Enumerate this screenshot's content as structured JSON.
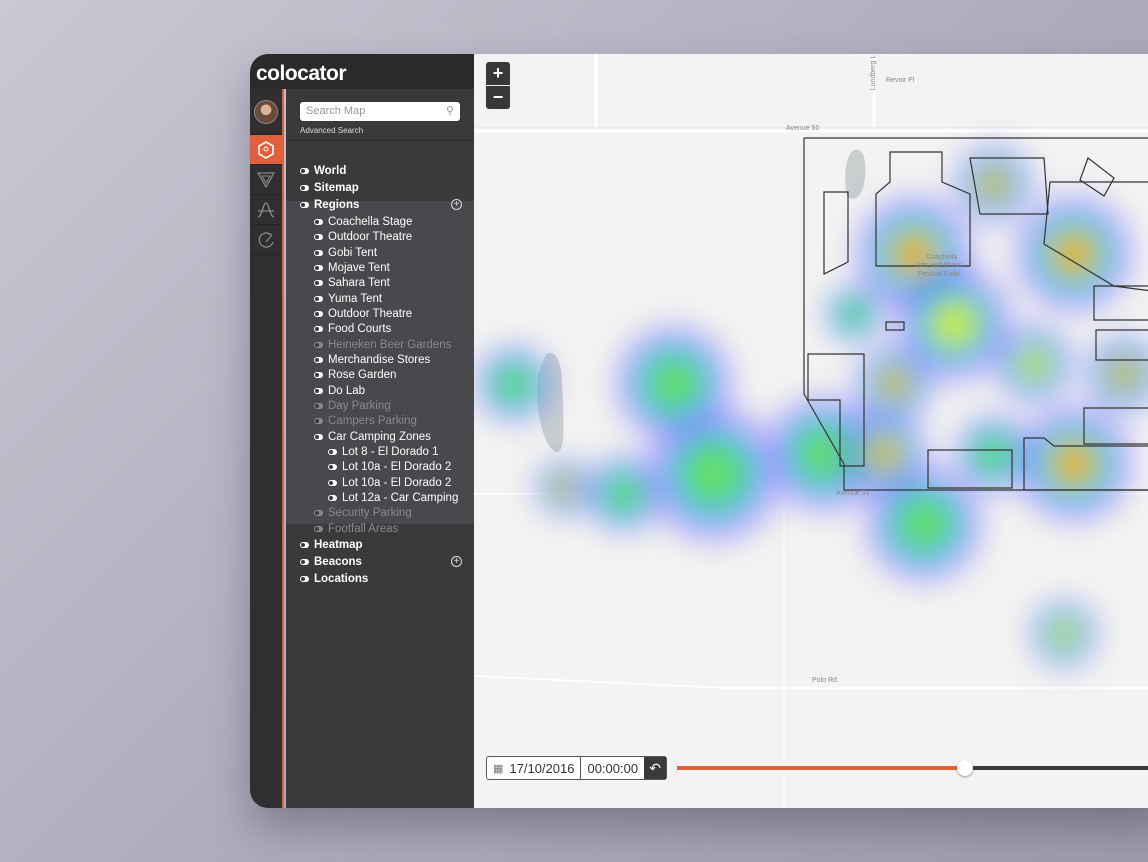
{
  "app": {
    "logo": "colocator"
  },
  "rail": [
    {
      "icon": "hexagon-icon",
      "active": true
    },
    {
      "icon": "triangle-filter-icon"
    },
    {
      "icon": "curve-icon"
    },
    {
      "icon": "gauge-icon"
    }
  ],
  "sidebar": {
    "search_placeholder": "Search Map",
    "advanced_search": "Advanced Search",
    "items": [
      {
        "label": "World",
        "level": 0,
        "on": true
      },
      {
        "label": "Sitemap",
        "level": 0,
        "on": true
      },
      {
        "label": "Regions",
        "level": 0,
        "on": true,
        "add": true
      },
      {
        "label": "Coachella Stage",
        "level": 1,
        "on": true
      },
      {
        "label": "Outdoor Theatre",
        "level": 1,
        "on": true
      },
      {
        "label": "Gobi Tent",
        "level": 1,
        "on": true
      },
      {
        "label": "Mojave Tent",
        "level": 1,
        "on": true
      },
      {
        "label": "Sahara Tent",
        "level": 1,
        "on": true
      },
      {
        "label": "Yuma Tent",
        "level": 1,
        "on": true
      },
      {
        "label": "Outdoor Theatre",
        "level": 1,
        "on": true
      },
      {
        "label": "Food Courts",
        "level": 1,
        "on": true
      },
      {
        "label": "Heineken Beer Gardens",
        "level": 1,
        "on": false
      },
      {
        "label": "Merchandise Stores",
        "level": 1,
        "on": true
      },
      {
        "label": "Rose Garden",
        "level": 1,
        "on": true
      },
      {
        "label": "Do Lab",
        "level": 1,
        "on": true
      },
      {
        "label": "Day Parking",
        "level": 1,
        "on": false
      },
      {
        "label": "Campers Parking",
        "level": 1,
        "on": false
      },
      {
        "label": "Car Camping Zones",
        "level": 1,
        "on": true
      },
      {
        "label": "Lot 8 - El Dorado 1",
        "level": 2,
        "on": true
      },
      {
        "label": "Lot 10a - El Dorado 2",
        "level": 2,
        "on": true
      },
      {
        "label": "Lot 10a - El Dorado 2",
        "level": 2,
        "on": true
      },
      {
        "label": "Lot 12a - Car Camping",
        "level": 2,
        "on": true
      },
      {
        "label": "Security Parking",
        "level": 1,
        "on": false
      },
      {
        "label": "Footfall Areas",
        "level": 1,
        "on": false
      },
      {
        "label": "Heatmap",
        "level": 0,
        "on": true
      },
      {
        "label": "Beacons",
        "level": 0,
        "on": true,
        "add": true
      },
      {
        "label": "Locations",
        "level": 0,
        "on": true
      }
    ]
  },
  "map": {
    "zoom_in": "+",
    "zoom_out": "−",
    "labels": {
      "avenue50": "Avenue 50",
      "lundberg": "Lundberg L",
      "revoir": "Revoir Pl",
      "avenue51": "Avenue 51",
      "polo": "Polo Rd",
      "venue1": "Coachella",
      "venue2": "Arts and Music",
      "venue3": "Festival Field"
    }
  },
  "timeline": {
    "date": "17/10/2016",
    "time": "00:00:00",
    "progress": 0.6
  },
  "colors": {
    "accent": "#e0603b",
    "sidebar": "#3a3a3c"
  }
}
